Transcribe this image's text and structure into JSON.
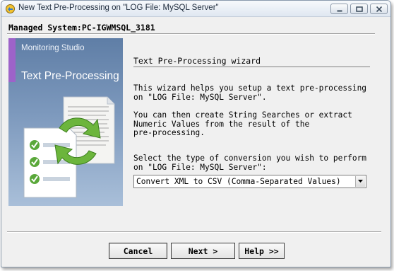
{
  "window": {
    "title": "New Text Pre-Processing on \"LOG File: MySQL Server\""
  },
  "header": {
    "managed_system": "Managed System:PC-IGWMSQL_3181"
  },
  "banner": {
    "brand": "Monitoring Studio",
    "heading": "Text Pre-Processing"
  },
  "wizard": {
    "title": "Text Pre-Processing wizard",
    "paragraph1": "This wizard helps you setup a text pre-processing\non \"LOG File: MySQL Server\".",
    "paragraph2": "You can then create String Searches or extract\nNumeric Values from the result of the\npre-processing.",
    "select_prompt": "Select the type of conversion you wish to perform\non \"LOG File: MySQL Server\":",
    "conversion_selected": "Convert XML to CSV (Comma-Separated Values)"
  },
  "buttons": {
    "cancel": "Cancel",
    "next": "Next >",
    "help": "Help >>"
  },
  "colors": {
    "banner": "#6f8db4",
    "banner_accent": "#9d63c9",
    "window_bg": "#f0f0f0"
  }
}
